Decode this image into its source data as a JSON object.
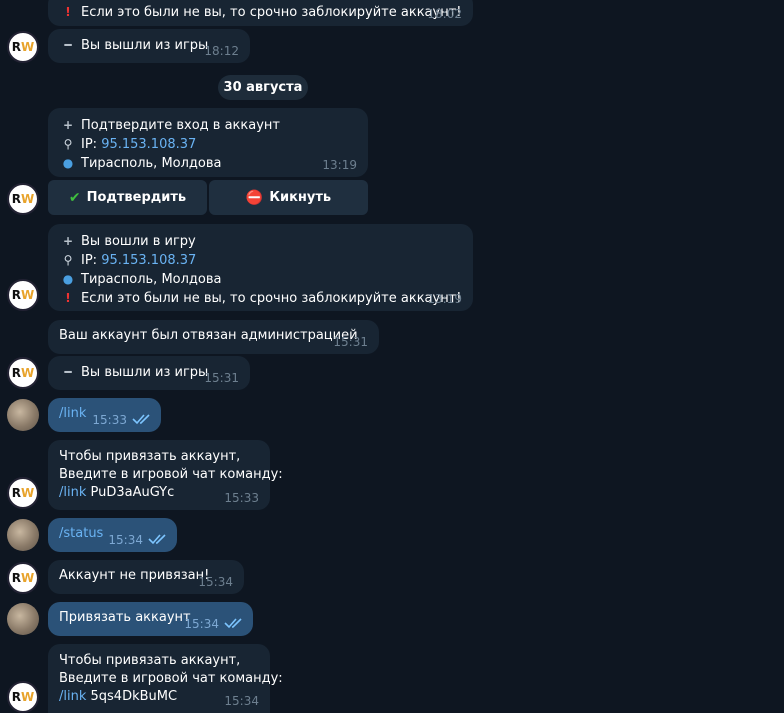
{
  "messages": {
    "m0": {
      "text": "Если это были не вы, то срочно заблокируйте аккаунт!",
      "time": "18:02"
    },
    "m1": {
      "text": "Вы вышли из игры",
      "time": "18:12"
    },
    "date": "30 августа",
    "m2": {
      "line1": "Подтвердите вход в аккаунт",
      "ip_label": "IP: ",
      "ip": "95.153.108.37",
      "location": "Тирасполь, Молдова",
      "time": "13:19"
    },
    "buttons": {
      "confirm": "Подтвердить",
      "kick": "Кикнуть"
    },
    "m3": {
      "line1": "Вы вошли в игру",
      "ip_label": "IP: ",
      "ip": "95.153.108.37",
      "location": "Тирасполь, Молдова",
      "warning": "Если это были не вы, то срочно заблокируйте аккаунт!",
      "time": "13:19"
    },
    "m4": {
      "text": "Ваш аккаунт был отвязан администрацией",
      "time": "15:31"
    },
    "m5": {
      "text": "Вы вышли из игры",
      "time": "15:31"
    },
    "m6": {
      "text": "/link",
      "time": "15:33"
    },
    "m7": {
      "line1": "Чтобы привязать аккаунт,",
      "line2": "Введите в игровой чат команду:",
      "cmd": "/link",
      "code": " PuD3aAuGYc",
      "time": "15:33"
    },
    "m8": {
      "text": "/status",
      "time": "15:34"
    },
    "m9": {
      "text": "Аккаунт не привязан!",
      "time": "15:34"
    },
    "m10": {
      "text": "Привязать аккаунт",
      "time": "15:34"
    },
    "m11": {
      "line1": "Чтобы привязать аккаунт,",
      "line2": "Введите в игровой чат команду:",
      "cmd": "/link",
      "code": " 5qs4DkBuMC",
      "time": "15:34"
    }
  },
  "icons": {
    "plus": "➕",
    "minus": "➖",
    "magnifier": "🔎",
    "globe": "🌍",
    "exclamation": "❗",
    "check": "✅",
    "no_entry": "⛔"
  }
}
